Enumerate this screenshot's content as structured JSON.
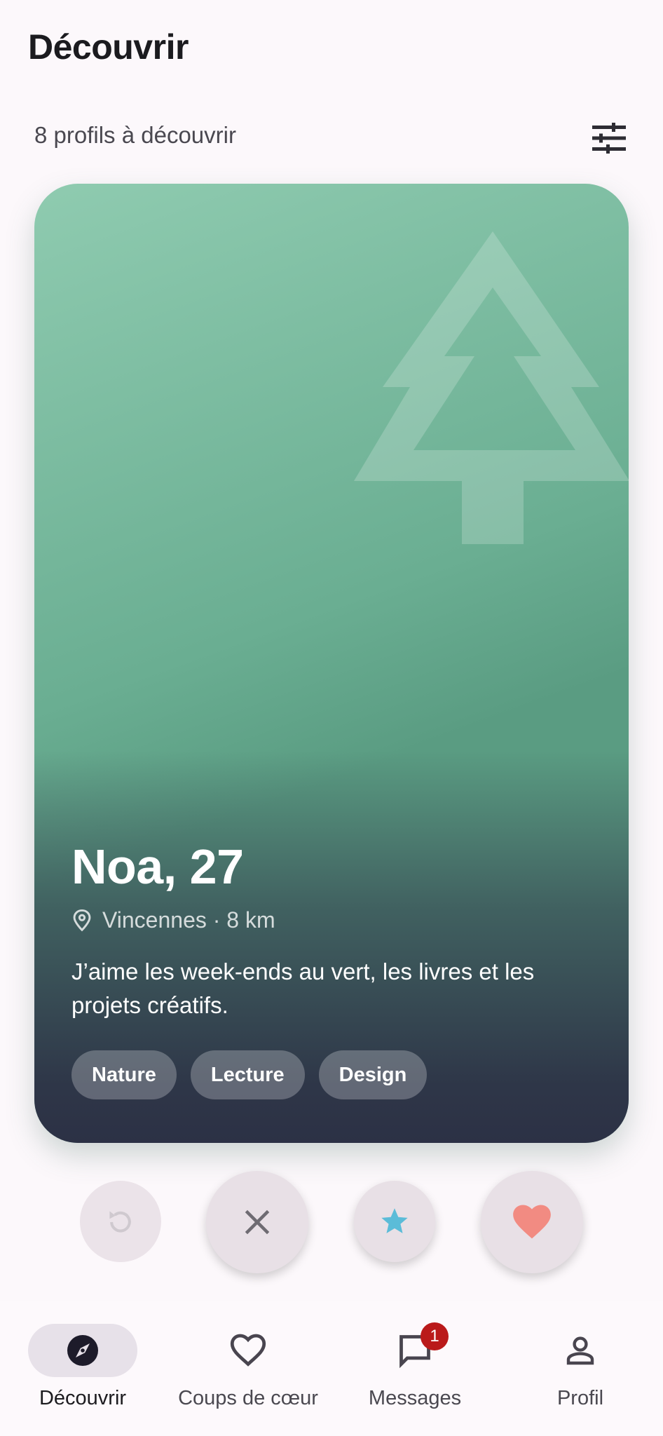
{
  "header": {
    "title": "Découvrir"
  },
  "discover": {
    "count_label": "8 profils à découvrir",
    "filter_icon": "tune-icon"
  },
  "card": {
    "name_age": "Noa, 27",
    "location": "Vincennes · 8 km",
    "bio": "J’aime les week-ends au vert, les livres et les projets créatifs.",
    "tags": [
      "Nature",
      "Lecture",
      "Design"
    ],
    "illustration": "pine-tree-icon",
    "colors": {
      "gradient_top": "#8fcbb0",
      "gradient_bottom": "#2c3145"
    }
  },
  "actions": {
    "undo": {
      "icon": "undo-icon"
    },
    "pass": {
      "icon": "close-icon"
    },
    "super_like": {
      "icon": "star-icon",
      "color": "#5bbcd8"
    },
    "like": {
      "icon": "heart-icon",
      "color": "#f28b82"
    }
  },
  "nav": {
    "items": [
      {
        "label": "Découvrir",
        "icon": "compass-icon",
        "active": true
      },
      {
        "label": "Coups de cœur",
        "icon": "heart-outline-icon"
      },
      {
        "label": "Messages",
        "icon": "chat-icon",
        "badge": "1"
      },
      {
        "label": "Profil",
        "icon": "person-icon"
      }
    ]
  }
}
